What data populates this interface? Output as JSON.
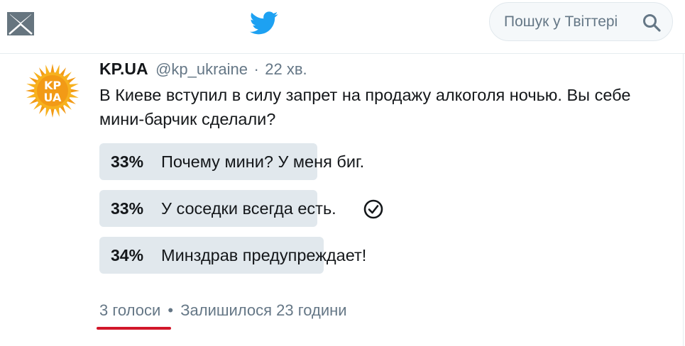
{
  "header": {
    "search_placeholder": "Пошук у Твіттері",
    "icons": [
      "mail-icon",
      "twitter-bird-icon",
      "search-icon"
    ],
    "brand_color": "#1da1f2"
  },
  "tweet": {
    "author_name": "KP.UA",
    "author_handle": "@kp_ukraine",
    "separator": "·",
    "time": "22 хв.",
    "avatar_text": "KP UA",
    "text": "В Киеве вступил в силу запрет на продажу алкоголя ночью. Вы себе\nмини-барчик сделали?"
  },
  "poll": {
    "options": [
      {
        "percent": "33%",
        "label": "Почему мини? У меня биг.",
        "fill": 0.33,
        "selected": false
      },
      {
        "percent": "33%",
        "label": "У соседки всегда есть.",
        "fill": 0.33,
        "selected": true
      },
      {
        "percent": "34%",
        "label": "Минздрав предупреждает!",
        "fill": 0.34,
        "selected": false
      }
    ],
    "votes": "3 голоси",
    "dot": "•",
    "time_left": "Залишилося 23 години",
    "annotation_color": "#d2172a"
  }
}
